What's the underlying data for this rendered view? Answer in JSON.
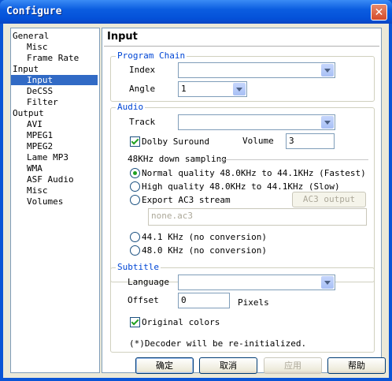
{
  "window": {
    "title": "Configure",
    "close_glyph": "✕"
  },
  "tree": {
    "items": [
      {
        "label": "General",
        "level": 0,
        "selected": false
      },
      {
        "label": "Misc",
        "level": 1,
        "selected": false
      },
      {
        "label": "Frame Rate",
        "level": 1,
        "selected": false
      },
      {
        "label": "Input",
        "level": 0,
        "selected": false
      },
      {
        "label": "Input",
        "level": 1,
        "selected": true
      },
      {
        "label": "DeCSS",
        "level": 1,
        "selected": false
      },
      {
        "label": "Filter",
        "level": 1,
        "selected": false
      },
      {
        "label": "Output",
        "level": 0,
        "selected": false
      },
      {
        "label": "AVI",
        "level": 1,
        "selected": false
      },
      {
        "label": "MPEG1",
        "level": 1,
        "selected": false
      },
      {
        "label": "MPEG2",
        "level": 1,
        "selected": false
      },
      {
        "label": "Lame MP3",
        "level": 1,
        "selected": false
      },
      {
        "label": "WMA",
        "level": 1,
        "selected": false
      },
      {
        "label": "ASF Audio",
        "level": 1,
        "selected": false
      },
      {
        "label": "Misc",
        "level": 1,
        "selected": false
      },
      {
        "label": "Volumes",
        "level": 1,
        "selected": false
      }
    ]
  },
  "panel": {
    "title": "Input",
    "program_chain": {
      "label": "Program Chain",
      "index_label": "Index",
      "index_value": "",
      "angle_label": "Angle",
      "angle_value": "1"
    },
    "audio": {
      "label": "Audio",
      "track_label": "Track",
      "track_value": "",
      "dolby_label": "Dolby Suround",
      "dolby_checked": true,
      "volume_label": "Volume",
      "volume_value": "3",
      "downsampling_label": "48KHz down sampling",
      "options": [
        {
          "label": "Normal quality 48.0KHz to 44.1KHz (Fastest)",
          "selected": true
        },
        {
          "label": "High quality 48.0KHz to 44.1KHz (Slow)",
          "selected": false
        },
        {
          "label": "Export AC3 stream",
          "selected": false
        }
      ],
      "ac3_button": "AC3 output",
      "ac3_file": "none.ac3",
      "options2": [
        {
          "label": "44.1 KHz (no conversion)",
          "selected": false
        },
        {
          "label": "48.0 KHz (no conversion)",
          "selected": false
        }
      ]
    },
    "subtitle": {
      "label": "Subtitle",
      "language_label": "Language",
      "language_value": "",
      "offset_label": "Offset",
      "offset_value": "0",
      "pixels_label": "Pixels",
      "original_colors_label": "Original colors",
      "original_colors_checked": true
    },
    "note": "(*)Decoder will be re-initialized."
  },
  "buttons": {
    "ok": "确定",
    "cancel": "取消",
    "apply": "应用",
    "help": "帮助"
  }
}
